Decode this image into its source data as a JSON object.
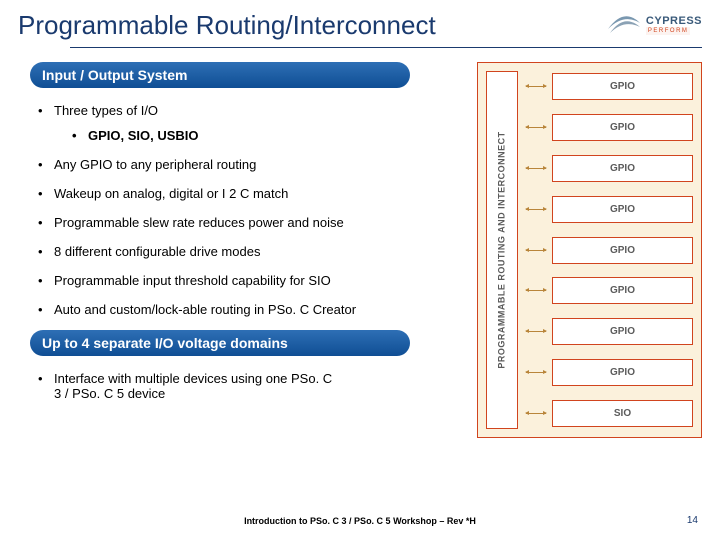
{
  "title": "Programmable Routing/Interconnect",
  "logo": {
    "name": "CYPRESS",
    "sub": "PERFORM"
  },
  "section1": {
    "heading": "Input / Output System",
    "bullets": [
      "Three types of I/O",
      "Any GPIO to any peripheral routing",
      "Wakeup on analog, digital or I 2 C match",
      "Programmable slew rate reduces power and noise",
      "8 different configurable drive modes",
      "Programmable input threshold capability for SIO",
      "Auto and custom/lock-able routing in PSo. C Creator"
    ],
    "sub_bullet": "GPIO, SIO, USBIO"
  },
  "section2": {
    "heading": "Up to 4 separate I/O voltage domains",
    "bullets": [
      "Interface with multiple devices using one PSo. C 3 / PSo. C 5 device"
    ]
  },
  "diagram": {
    "vbar_label": "PROGRAMMABLE ROUTING AND INTERCONNECT",
    "boxes": [
      "GPIO",
      "GPIO",
      "GPIO",
      "GPIO",
      "GPIO",
      "GPIO",
      "GPIO",
      "GPIO",
      "SIO"
    ]
  },
  "footer": "Introduction to PSo. C 3 / PSo. C 5 Workshop – Rev *H",
  "page_number": "14"
}
